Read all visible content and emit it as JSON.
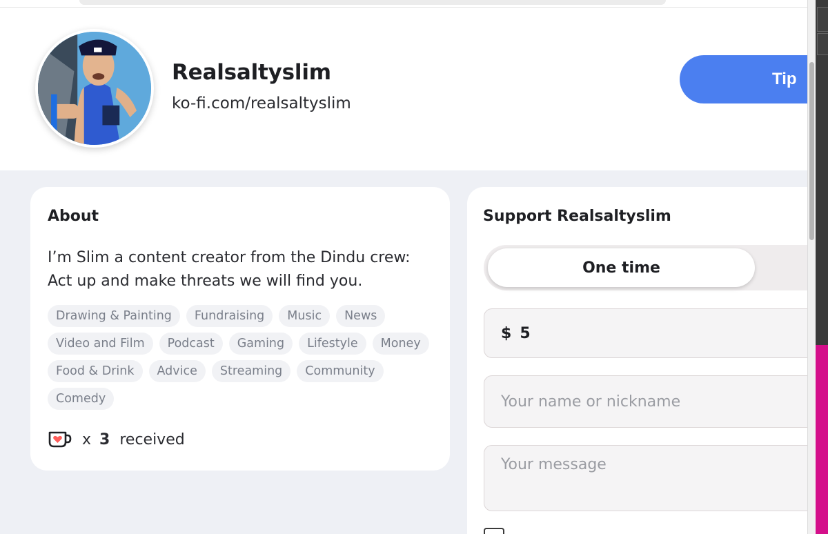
{
  "creator": {
    "name": "Realsaltyslim",
    "url": "ko-fi.com/realsaltyslim",
    "tip_label": "Tip"
  },
  "about": {
    "title": "About",
    "text": "I’m Slim a content creator from the Dindu crew: Act up and make threats we will find you.",
    "tags": [
      "Drawing & Painting",
      "Fundraising",
      "Music",
      "News",
      "Video and Film",
      "Podcast",
      "Gaming",
      "Lifestyle",
      "Money",
      "Food & Drink",
      "Advice",
      "Streaming",
      "Community",
      "Comedy"
    ],
    "received": {
      "icon": "kofi-cup-icon",
      "multiplier": "x",
      "count": "3",
      "label": "received"
    }
  },
  "support": {
    "title": "Support Realsaltyslim",
    "frequency_selected": "One time",
    "currency_symbol": "$",
    "amount": "5",
    "name_placeholder": "Your name or nickname",
    "message_placeholder": "Your message"
  },
  "colors": {
    "accent": "#4b7ff0",
    "page_background": "#eef0f5",
    "kofi_red": "#ff5e5b"
  }
}
